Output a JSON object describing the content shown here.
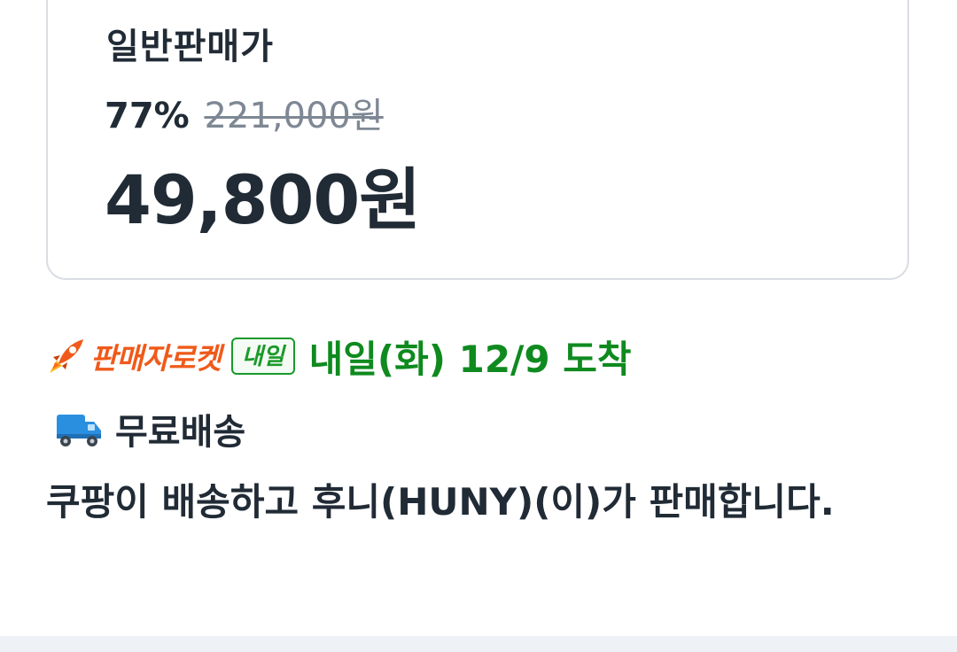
{
  "price_card": {
    "label": "일반판매가",
    "discount_rate": "77%",
    "original_price": "221,000원",
    "final_price": "49,800원"
  },
  "delivery": {
    "rocket_icon": "rocket-icon",
    "rocket_brand": "판매자로켓",
    "tomorrow_badge": "내일",
    "arrival_text": "내일(화) 12/9 도착",
    "arrival_color": "#0f8a1f",
    "brand_color": "#ef5a1a"
  },
  "shipping": {
    "truck_icon": "truck-icon",
    "text": "무료배송"
  },
  "seller": {
    "description": "쿠팡이 배송하고 후니(HUNY)(이)가 판매합니다."
  }
}
